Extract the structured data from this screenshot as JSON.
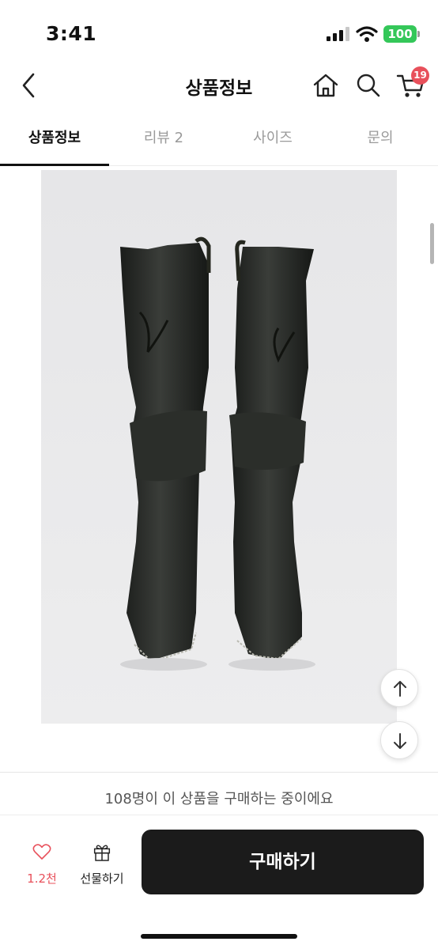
{
  "status": {
    "time": "3:41",
    "battery": "100"
  },
  "header": {
    "title": "상품정보",
    "cart_count": "19"
  },
  "tabs": [
    {
      "label": "상품정보",
      "active": true
    },
    {
      "label": "리뷰 2",
      "active": false
    },
    {
      "label": "사이즈",
      "active": false
    },
    {
      "label": "문의",
      "active": false
    }
  ],
  "product": {
    "buyers_text": "108명이 이 상품을 구매하는 중이에요"
  },
  "bottom_bar": {
    "like_count": "1.2천",
    "gift_label": "선물하기",
    "buy_label": "구매하기"
  },
  "colors": {
    "accent": "#e8505b",
    "battery": "#34c759",
    "buy_button": "#1b1b1b"
  },
  "icons": [
    "back-icon",
    "home-icon",
    "search-icon",
    "cart-icon",
    "arrow-up-icon",
    "arrow-down-icon",
    "heart-icon",
    "gift-icon"
  ]
}
